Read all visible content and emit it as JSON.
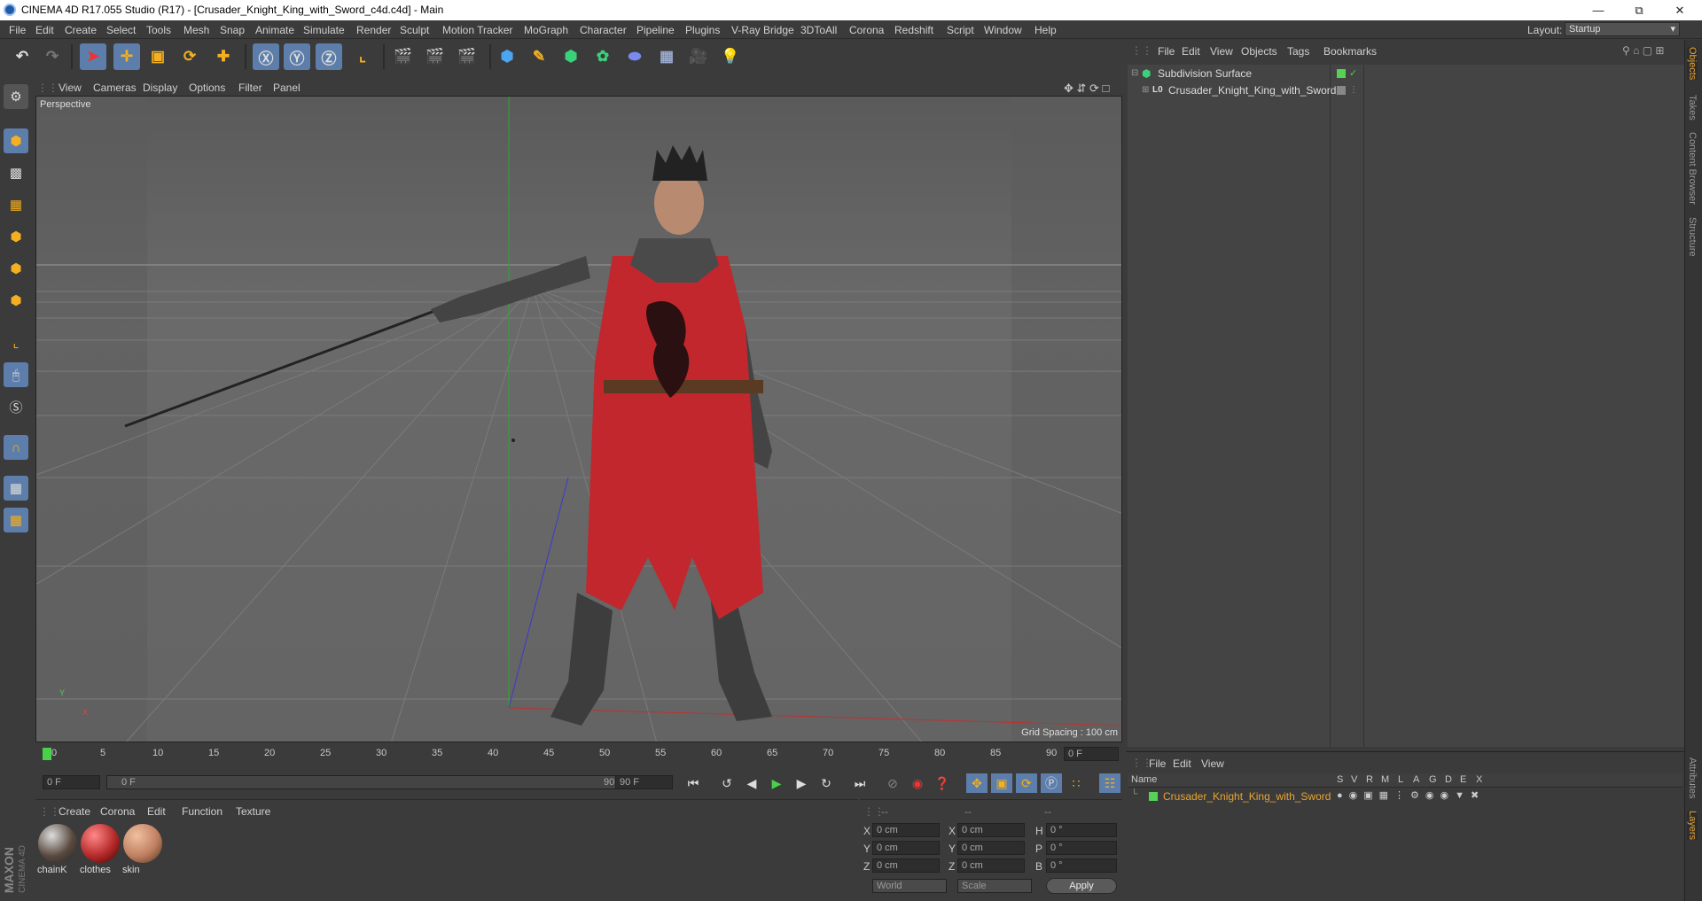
{
  "window": {
    "title": "CINEMA 4D R17.055 Studio (R17) - [Crusader_Knight_King_with_Sword_c4d.c4d] - Main"
  },
  "menu": [
    "File",
    "Edit",
    "Create",
    "Select",
    "Tools",
    "Mesh",
    "Snap",
    "Animate",
    "Simulate",
    "Render",
    "Sculpt",
    "Motion Tracker",
    "MoGraph",
    "Character",
    "Pipeline",
    "Plugins",
    "V-Ray Bridge",
    "3DToAll",
    "Corona",
    "Redshift",
    "Script",
    "Window",
    "Help"
  ],
  "layout": {
    "label": "Layout:",
    "value": "Startup"
  },
  "viewport": {
    "menu": [
      "View",
      "Cameras",
      "Display",
      "Options",
      "Filter",
      "Panel"
    ],
    "name": "Perspective",
    "grid_spacing": "Grid Spacing : 100 cm",
    "axis_y": "Y",
    "axis_x": "X"
  },
  "timeline": {
    "ticks": [
      "0",
      "5",
      "10",
      "15",
      "20",
      "25",
      "30",
      "35",
      "40",
      "45",
      "50",
      "55",
      "60",
      "65",
      "70",
      "75",
      "80",
      "85",
      "90"
    ],
    "current_frame": "0 F",
    "start_field": "0 F",
    "range_start": "0 F",
    "range_end": "90 F",
    "end_field": "90 F"
  },
  "materials": {
    "menu": [
      "Create",
      "Corona",
      "Edit",
      "Function",
      "Texture"
    ],
    "items": [
      {
        "label": "chainK",
        "color": "#7a6a60"
      },
      {
        "label": "clothes",
        "color": "#b52a2a"
      },
      {
        "label": "skin",
        "color": "#c08060"
      }
    ]
  },
  "coords": {
    "head": [
      "--",
      "--",
      "--"
    ],
    "rows": [
      {
        "a": "X",
        "av": "0 cm",
        "b": "X",
        "bv": "0 cm",
        "c": "H",
        "cv": "0 °"
      },
      {
        "a": "Y",
        "av": "0 cm",
        "b": "Y",
        "bv": "0 cm",
        "c": "P",
        "cv": "0 °"
      },
      {
        "a": "Z",
        "av": "0 cm",
        "b": "Z",
        "bv": "0 cm",
        "c": "B",
        "cv": "0 °"
      }
    ],
    "space": "World",
    "mode": "Scale",
    "apply": "Apply"
  },
  "objects": {
    "menu": [
      "File",
      "Edit",
      "View",
      "Objects",
      "Tags",
      "Bookmarks"
    ],
    "items": [
      {
        "name": "Subdivision Surface",
        "color": "#56d156"
      },
      {
        "name": "Crusader_Knight_King_with_Sword",
        "color": "#888888"
      }
    ]
  },
  "layers": {
    "menu": [
      "File",
      "Edit",
      "View"
    ],
    "header_name": "Name",
    "cols": [
      "S",
      "V",
      "R",
      "M",
      "L",
      "A",
      "G",
      "D",
      "E",
      "X"
    ],
    "row": {
      "name": "Crusader_Knight_King_with_Sword",
      "color": "#e8a431"
    }
  },
  "side_tabs": [
    "Objects",
    "Takes",
    "Content Browser",
    "Structure",
    "Attributes",
    "Layers"
  ],
  "brand": {
    "maxon": "MAXON",
    "c4d": "CINEMA 4D"
  }
}
